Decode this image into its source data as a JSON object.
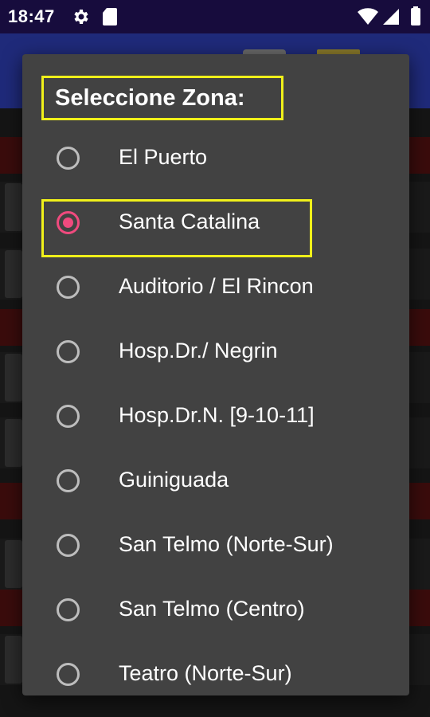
{
  "status_bar": {
    "time": "18:47",
    "icons": [
      "gear-icon",
      "sd-card-icon",
      "wifi-icon",
      "signal-icon",
      "battery-icon"
    ]
  },
  "dialog": {
    "title": "Seleccione Zona:",
    "selected": "Santa Catalina",
    "options": [
      {
        "label": "El Puerto",
        "selected": false
      },
      {
        "label": "Santa Catalina",
        "selected": true
      },
      {
        "label": "Auditorio / El Rincon",
        "selected": false
      },
      {
        "label": "Hosp.Dr./ Negrin",
        "selected": false
      },
      {
        "label": "Hosp.Dr.N. [9-10-11]",
        "selected": false
      },
      {
        "label": "Guiniguada",
        "selected": false
      },
      {
        "label": "San Telmo (Norte-Sur)",
        "selected": false
      },
      {
        "label": "San Telmo (Centro)",
        "selected": false
      },
      {
        "label": "Teatro (Norte-Sur)",
        "selected": false
      }
    ]
  },
  "colors": {
    "status_bar": "#170c3d",
    "app_bar": "#1f2a7a",
    "dialog_bg": "#424242",
    "radio_selected": "#f04a7e",
    "radio_unselected": "#bdbdbd",
    "annotation_box": "#f0f01a"
  }
}
